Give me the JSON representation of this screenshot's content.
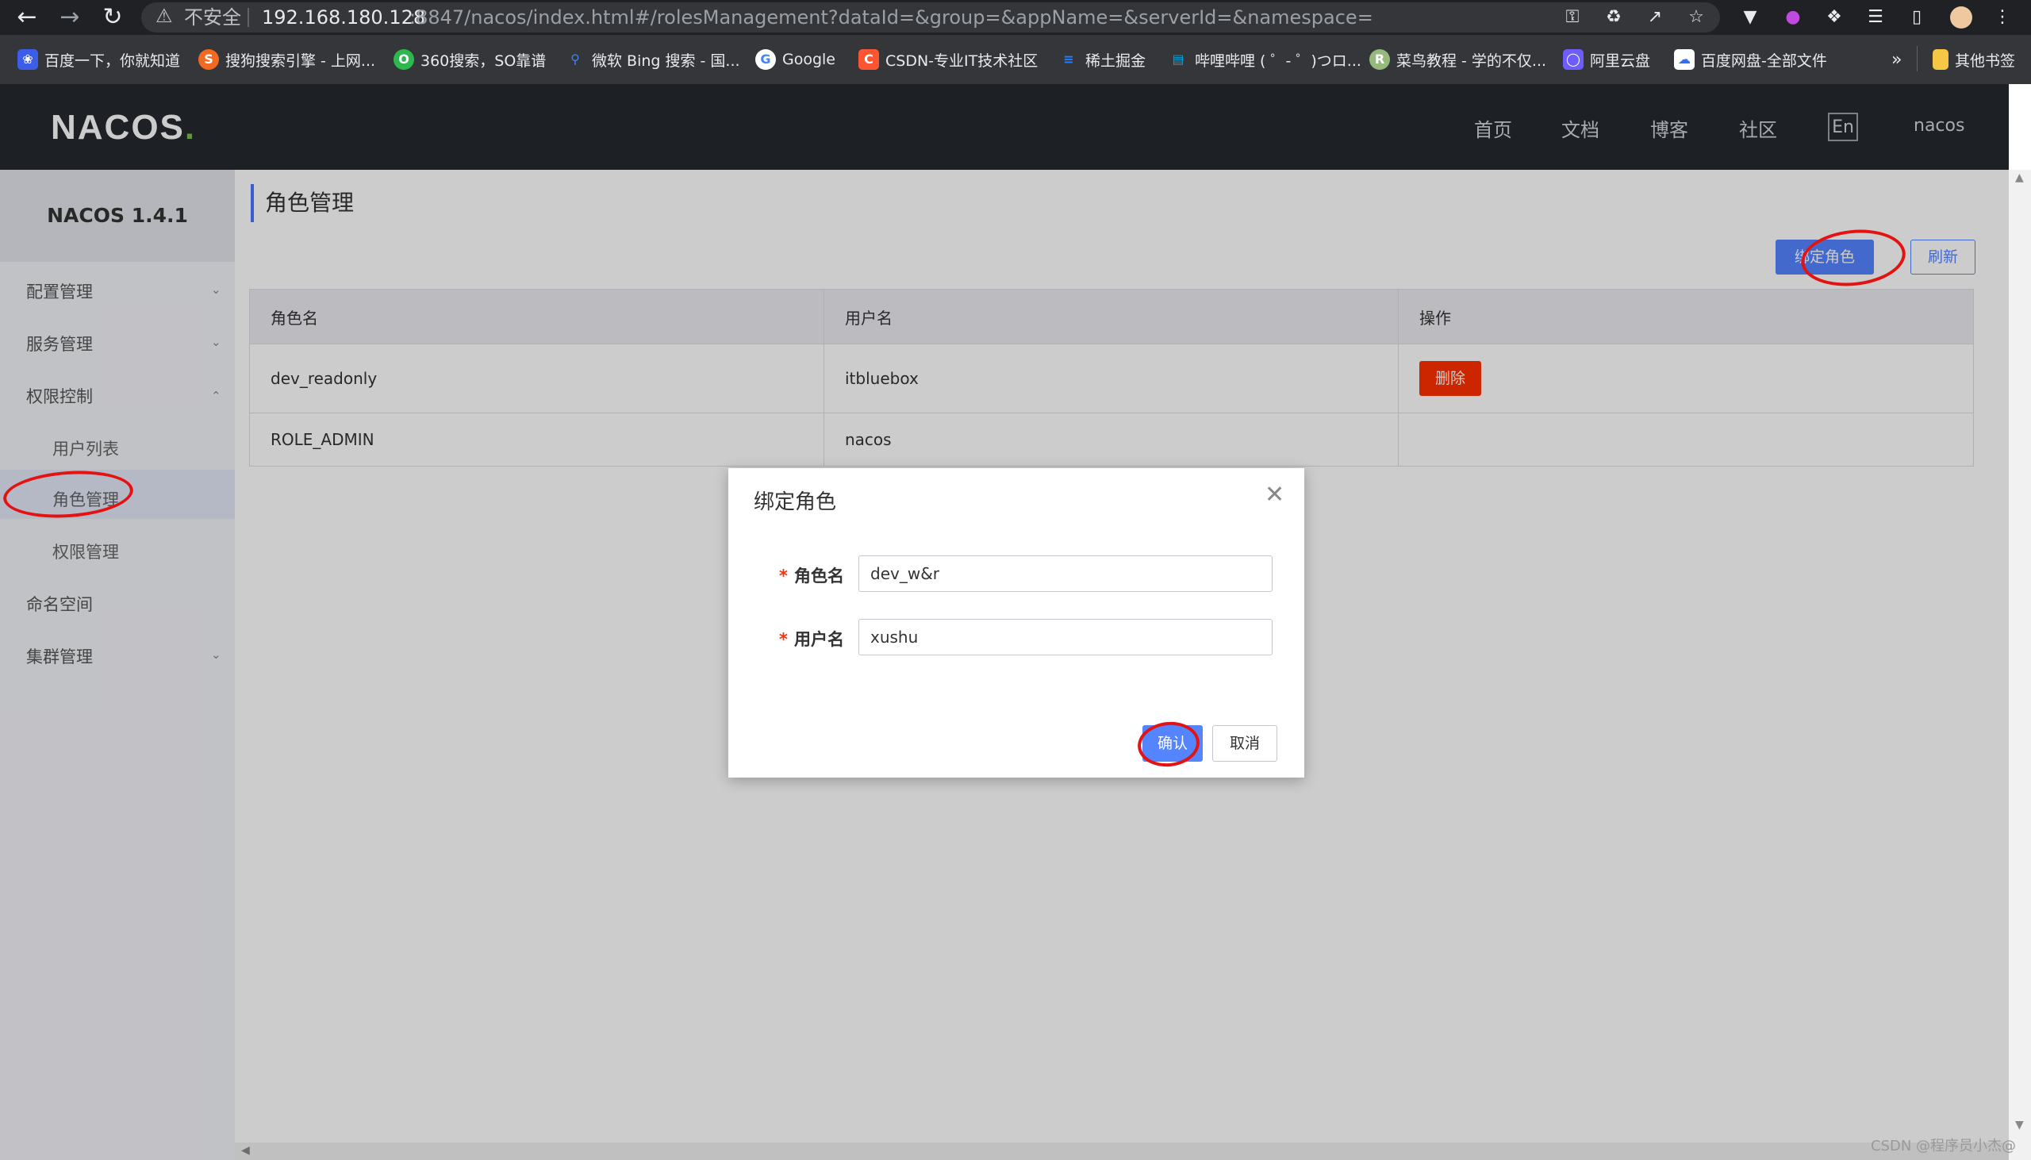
{
  "browser": {
    "insecure_label": "不安全",
    "url_host": "192.168.180.128",
    "url_path": ":8847/nacos/index.html#/rolesManagement?dataId=&group=&appName=&serverId=&namespace="
  },
  "bookmarks": [
    {
      "label": "百度一下，你就知道",
      "icon": "baidu-icon",
      "color": "#3b5de7"
    },
    {
      "label": "搜狗搜索引擎 - 上网...",
      "icon": "sogou-icon",
      "color": "#f26a21"
    },
    {
      "label": "360搜索，SO靠谱",
      "icon": "so360-icon",
      "color": "#2db84d"
    },
    {
      "label": "微软 Bing 搜索 - 国...",
      "icon": "bing-icon",
      "color": "#3b82f6"
    },
    {
      "label": "Google",
      "icon": "google-icon",
      "color": "#ffffff"
    },
    {
      "label": "CSDN-专业IT技术社区",
      "icon": "csdn-icon",
      "color": "#fc5531"
    },
    {
      "label": "稀土掘金",
      "icon": "juejin-icon",
      "color": "#1e80ff"
    },
    {
      "label": "哔哩哔哩 ( ゜- ゜)つロ...",
      "icon": "bilibili-icon",
      "color": "#00a1d6"
    },
    {
      "label": "菜鸟教程 - 学的不仅...",
      "icon": "runoob-icon",
      "color": "#96b97d"
    },
    {
      "label": "阿里云盘",
      "icon": "aliyun-drive-icon",
      "color": "#6d5dfc"
    },
    {
      "label": "百度网盘-全部文件",
      "icon": "baidu-pan-icon",
      "color": "#2f6ff6"
    }
  ],
  "bookmarks_more": "»",
  "bookmarks_other": "其他书签",
  "header": {
    "logo": "NACOS",
    "nav": [
      "首页",
      "文档",
      "博客",
      "社区"
    ],
    "lang": "En",
    "user": "nacos"
  },
  "sidebar": {
    "title": "NACOS 1.4.1",
    "items": [
      "配置管理",
      "服务管理",
      "权限控制",
      "命名空间",
      "集群管理"
    ],
    "sub_items": [
      "用户列表",
      "角色管理",
      "权限管理"
    ]
  },
  "page": {
    "title": "角色管理",
    "bind_button": "绑定角色",
    "refresh_button": "刷新"
  },
  "table": {
    "headers": [
      "角色名",
      "用户名",
      "操作"
    ],
    "rows": [
      {
        "role": "dev_readonly",
        "user": "itbluebox",
        "action": "删除"
      },
      {
        "role": "ROLE_ADMIN",
        "user": "nacos",
        "action": ""
      }
    ]
  },
  "dialog": {
    "title": "绑定角色",
    "role_label": "角色名",
    "role_value": "dev_w&r",
    "user_label": "用户名",
    "user_value": "xushu",
    "confirm": "确认",
    "cancel": "取消"
  },
  "watermark": "CSDN @程序员小杰@"
}
